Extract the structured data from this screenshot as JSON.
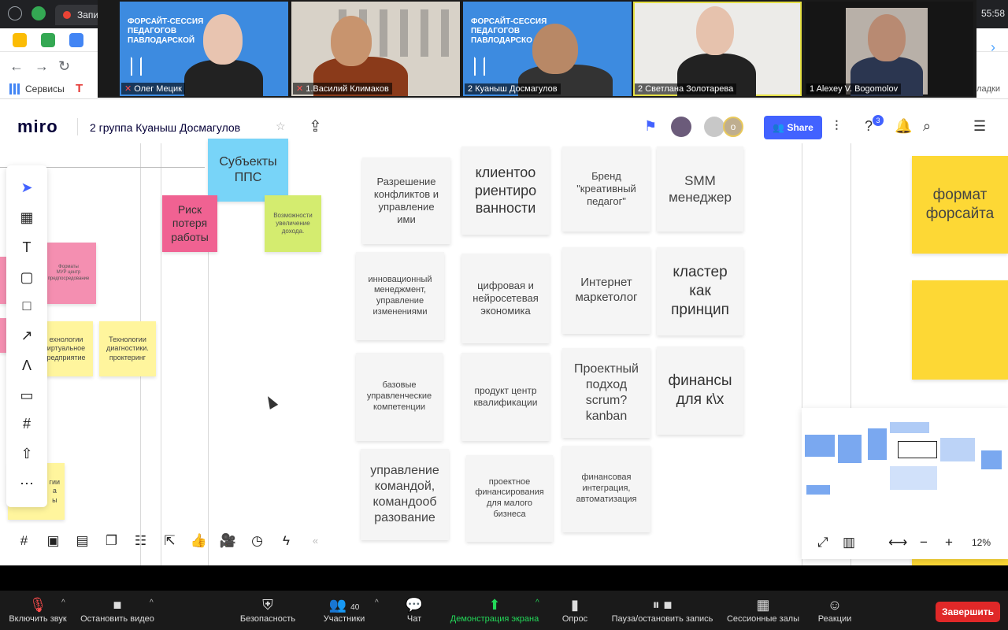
{
  "chrome": {
    "tab_label": "Запи",
    "clock": "55:58",
    "bookmark_servisy": "Сервисы",
    "bookmark_zakladki": "кладки",
    "ext_label": "ть"
  },
  "gallery": {
    "participants": [
      {
        "name": "Олег Мецик",
        "muted": true,
        "slide": "ФОРСАЙТ-СЕССИЯ\nПЕДАГОГОВ\nПАВЛОДАРСКОЙ"
      },
      {
        "name": "1.Василий Климаков",
        "muted": true
      },
      {
        "name": "2 Куаныш Досмагулов",
        "muted": false,
        "slide": "ФОРСАЙТ-СЕССИЯ\nПЕДАГОГОВ\nПАВЛОДАРСКО"
      },
      {
        "name": "2 Светлана Золотарева",
        "muted": false
      },
      {
        "name": "1 Alexey V. Bogomolov",
        "muted": false
      }
    ]
  },
  "miro": {
    "logo": "miro",
    "board_title": "2 группа Куаныш Досмагулов",
    "share_label": "Share",
    "notif_count": "3",
    "avatar_letter": "o",
    "zoom_level": "12%"
  },
  "stickies": {
    "subjects": "Субъекты\nППС",
    "risk": "Риск\nпотеря\nработы",
    "income": "Возможности\nувеличение\nдохода.",
    "formats": "Форматы\nМУР центр\nпредпосредование",
    "tech1": "ехнологии\nиртуальное\nредприятие",
    "tech2": "Технологии\nдиагностики.\nпроктеринг",
    "bottom_left": "гии\nа\nы",
    "conflict": "Разрешение\nконфликтов и\nуправление\nими",
    "client": "клиентоо\nриентиро\nванности",
    "brand": "Бренд\n\"креативный\nпедагог\"",
    "smm": "SMM\nменеджер",
    "innov": "инновационный\nменеджмент,\nуправление\nизменениями",
    "digital": "цифровая и\nнейросетевая\nэкономика",
    "internet": "Интернет\nмаркетолог",
    "cluster": "кластер\nкак\nпринцип",
    "basic": "базовые\nуправленческие\nкомпетенции",
    "product": "продукт центр\nквалификации",
    "project": "Проектный\nподход\nscrum?\nkanban",
    "finance": "финансы\nдля к\\х",
    "team": "управление\nкомандой,\nкомандооб\nразование",
    "projfin": "проектное\nфинансирования\nдля малого\nбизнеса",
    "fininteg": "финансовая\nинтеграция,\nавтоматизация",
    "format": "формат\nфорсайта"
  },
  "zoom_bar": {
    "mute": "Включить звук",
    "video": "Остановить видео",
    "security": "Безопасность",
    "participants": "Участники",
    "participants_count": "40",
    "chat": "Чат",
    "share": "Демонстрация экрана",
    "poll": "Опрос",
    "record": "Пауза/остановить запись",
    "rooms": "Сессионные залы",
    "reactions": "Реакции",
    "end": "Завершить"
  }
}
